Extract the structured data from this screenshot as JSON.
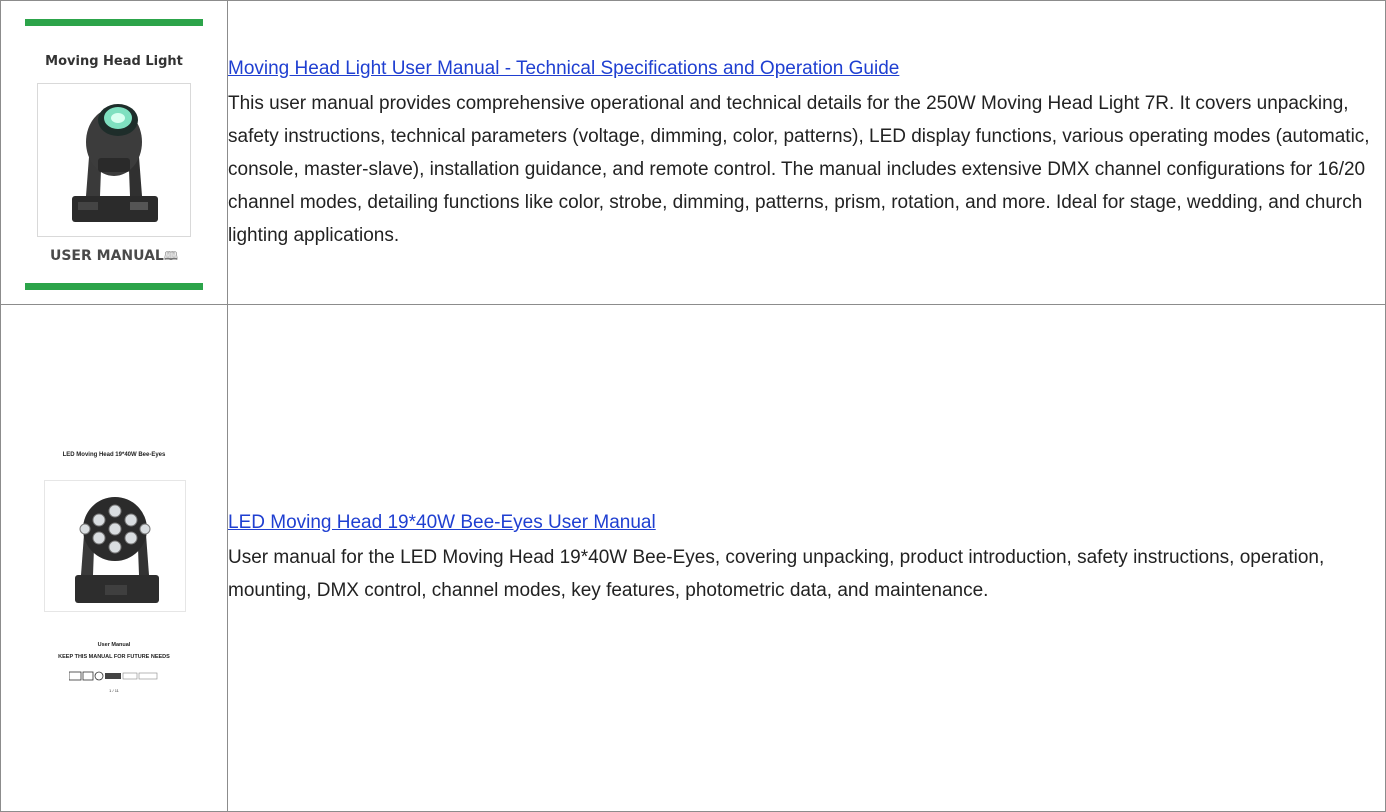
{
  "results": [
    {
      "title": "Moving Head Light User Manual - Technical Specifications and Operation Guide",
      "description": "This user manual provides comprehensive operational and technical details for the 250W Moving Head Light 7R. It covers unpacking, safety instructions, technical parameters (voltage, dimming, color, patterns), LED display functions, various operating modes (automatic, console, master-slave), installation guidance, and remote control. The manual includes extensive DMX channel configurations for 16/20 channel modes, detailing functions like color, strobe, dimming, patterns, prism, rotation, and more. Ideal for stage, wedding, and church lighting applications.",
      "thumbnail": {
        "heading": "Moving Head Light",
        "footer": "USER MANUAL",
        "icon": "book-icon",
        "accent_color": "#2ca44a"
      }
    },
    {
      "title": "LED Moving Head 19*40W Bee-Eyes User Manual",
      "description": "User manual for the LED Moving Head 19*40W Bee-Eyes, covering unpacking, product introduction, safety instructions, operation, mounting, DMX control, channel modes, key features, photometric data, and maintenance.",
      "thumbnail": {
        "heading": "LED Moving Head 19*40W Bee-Eyes",
        "subheading": "User Manual",
        "note": "KEEP THIS MANUAL FOR FUTURE NEEDS",
        "page": "1 / 11"
      }
    }
  ]
}
